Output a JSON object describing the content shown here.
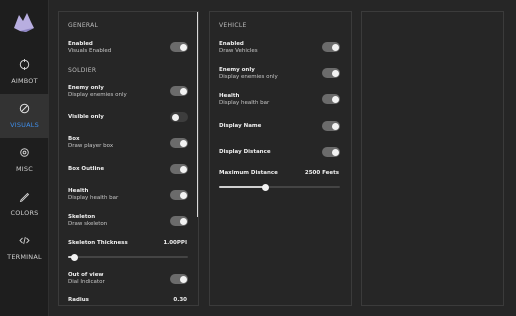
{
  "nav": {
    "items": [
      {
        "icon": "crosshair-icon",
        "label": "AIMBOT"
      },
      {
        "icon": "eye-icon",
        "label": "VISUALS"
      },
      {
        "icon": "gear-icon",
        "label": "MISC"
      },
      {
        "icon": "pen-icon",
        "label": "COLORS"
      },
      {
        "icon": "code-icon",
        "label": "TERMINAL"
      }
    ],
    "active": "VISUALS"
  },
  "left": {
    "general_title": "GENERAL",
    "enabled": {
      "title": "Enabled",
      "sub": "Visuals Enabled",
      "on": true
    },
    "soldier_title": "SOLDIER",
    "enemy_only": {
      "title": "Enemy only",
      "sub": "Display enemies only",
      "on": true
    },
    "visible_only": {
      "title": "Visible only",
      "on": false
    },
    "box": {
      "title": "Box",
      "sub": "Draw player box",
      "on": true
    },
    "box_outline": {
      "title": "Box Outline",
      "on": true
    },
    "health": {
      "title": "Health",
      "sub": "Display health bar",
      "on": true
    },
    "skeleton": {
      "title": "Skeleton",
      "sub": "Draw skeleton",
      "on": true
    },
    "skeleton_thickness": {
      "title": "Skeleton Thickness",
      "value": "1.00PPI",
      "fraction": 0.05
    },
    "out_of_view": {
      "title": "Out of view",
      "sub": "Dial Indicator",
      "on": true
    },
    "radius": {
      "title": "Radius",
      "value": "0.30"
    }
  },
  "mid": {
    "vehicle_title": "VEHICLE",
    "enabled": {
      "title": "Enabled",
      "sub": "Draw Vehicles",
      "on": true
    },
    "enemy_only": {
      "title": "Enemy only",
      "sub": "Display enemies only",
      "on": true
    },
    "health": {
      "title": "Health",
      "sub": "Display health bar",
      "on": true
    },
    "display_name": {
      "title": "Display Name",
      "on": true
    },
    "display_distance": {
      "title": "Display Distance",
      "on": true
    },
    "max_distance": {
      "title": "Maximum Distance",
      "value": "2500 Feets",
      "fraction": 0.38
    }
  }
}
